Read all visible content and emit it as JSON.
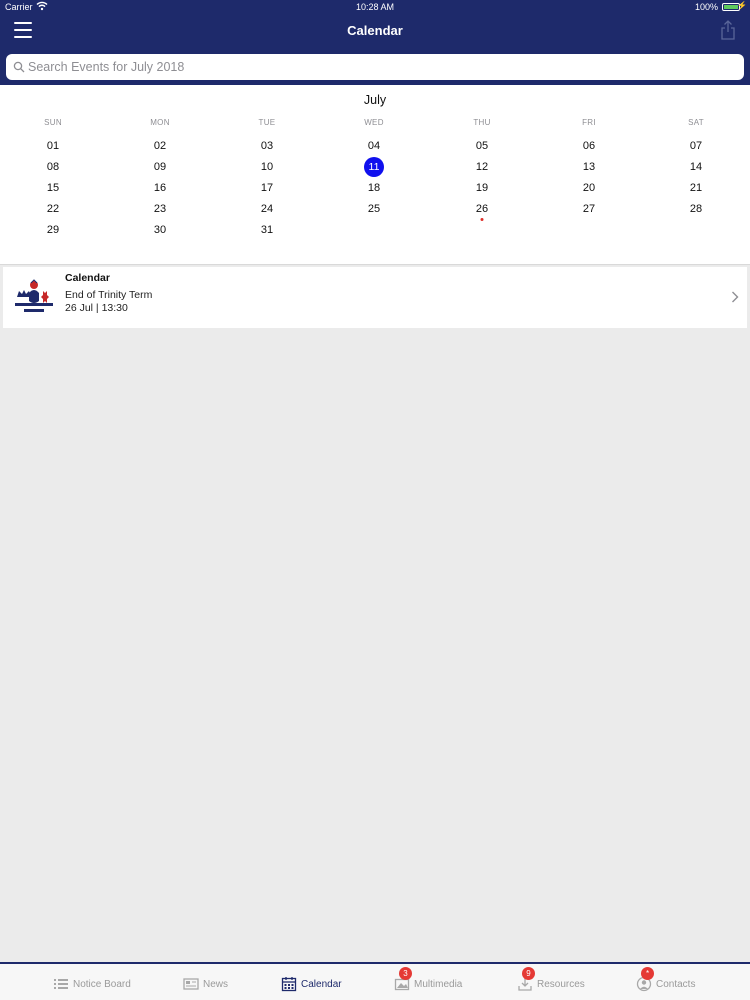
{
  "status_bar": {
    "carrier": "Carrier",
    "time": "10:28 AM",
    "battery": "100%"
  },
  "header": {
    "title": "Calendar"
  },
  "search": {
    "placeholder": "Search Events for July 2018"
  },
  "calendar": {
    "month": "July",
    "weekdays": [
      "SUN",
      "MON",
      "TUE",
      "WED",
      "THU",
      "FRI",
      "SAT"
    ],
    "weeks": [
      [
        "01",
        "02",
        "03",
        "04",
        "05",
        "06",
        "07"
      ],
      [
        "08",
        "09",
        "10",
        "11",
        "12",
        "13",
        "14"
      ],
      [
        "15",
        "16",
        "17",
        "18",
        "19",
        "20",
        "21"
      ],
      [
        "22",
        "23",
        "24",
        "25",
        "26",
        "27",
        "28"
      ],
      [
        "29",
        "30",
        "31",
        "",
        "",
        "",
        ""
      ]
    ],
    "selected_day": "11",
    "event_days": [
      "26"
    ]
  },
  "event": {
    "calendar": "Calendar",
    "title": "End of Trinity Term",
    "date": "26 Jul | 13:30"
  },
  "tabs": [
    {
      "label": "Notice Board",
      "icon": "list-icon",
      "badge": ""
    },
    {
      "label": "News",
      "icon": "newspaper-icon",
      "badge": ""
    },
    {
      "label": "Calendar",
      "icon": "calendar-icon",
      "badge": ""
    },
    {
      "label": "Multimedia",
      "icon": "multimedia-icon",
      "badge": "3"
    },
    {
      "label": "Resources",
      "icon": "download-icon",
      "badge": "9"
    },
    {
      "label": "Contacts",
      "icon": "contacts-icon",
      "badge": "*"
    }
  ],
  "colors": {
    "brand": "#1e2a6b",
    "selected": "#1010ee",
    "badge": "#e53935"
  }
}
